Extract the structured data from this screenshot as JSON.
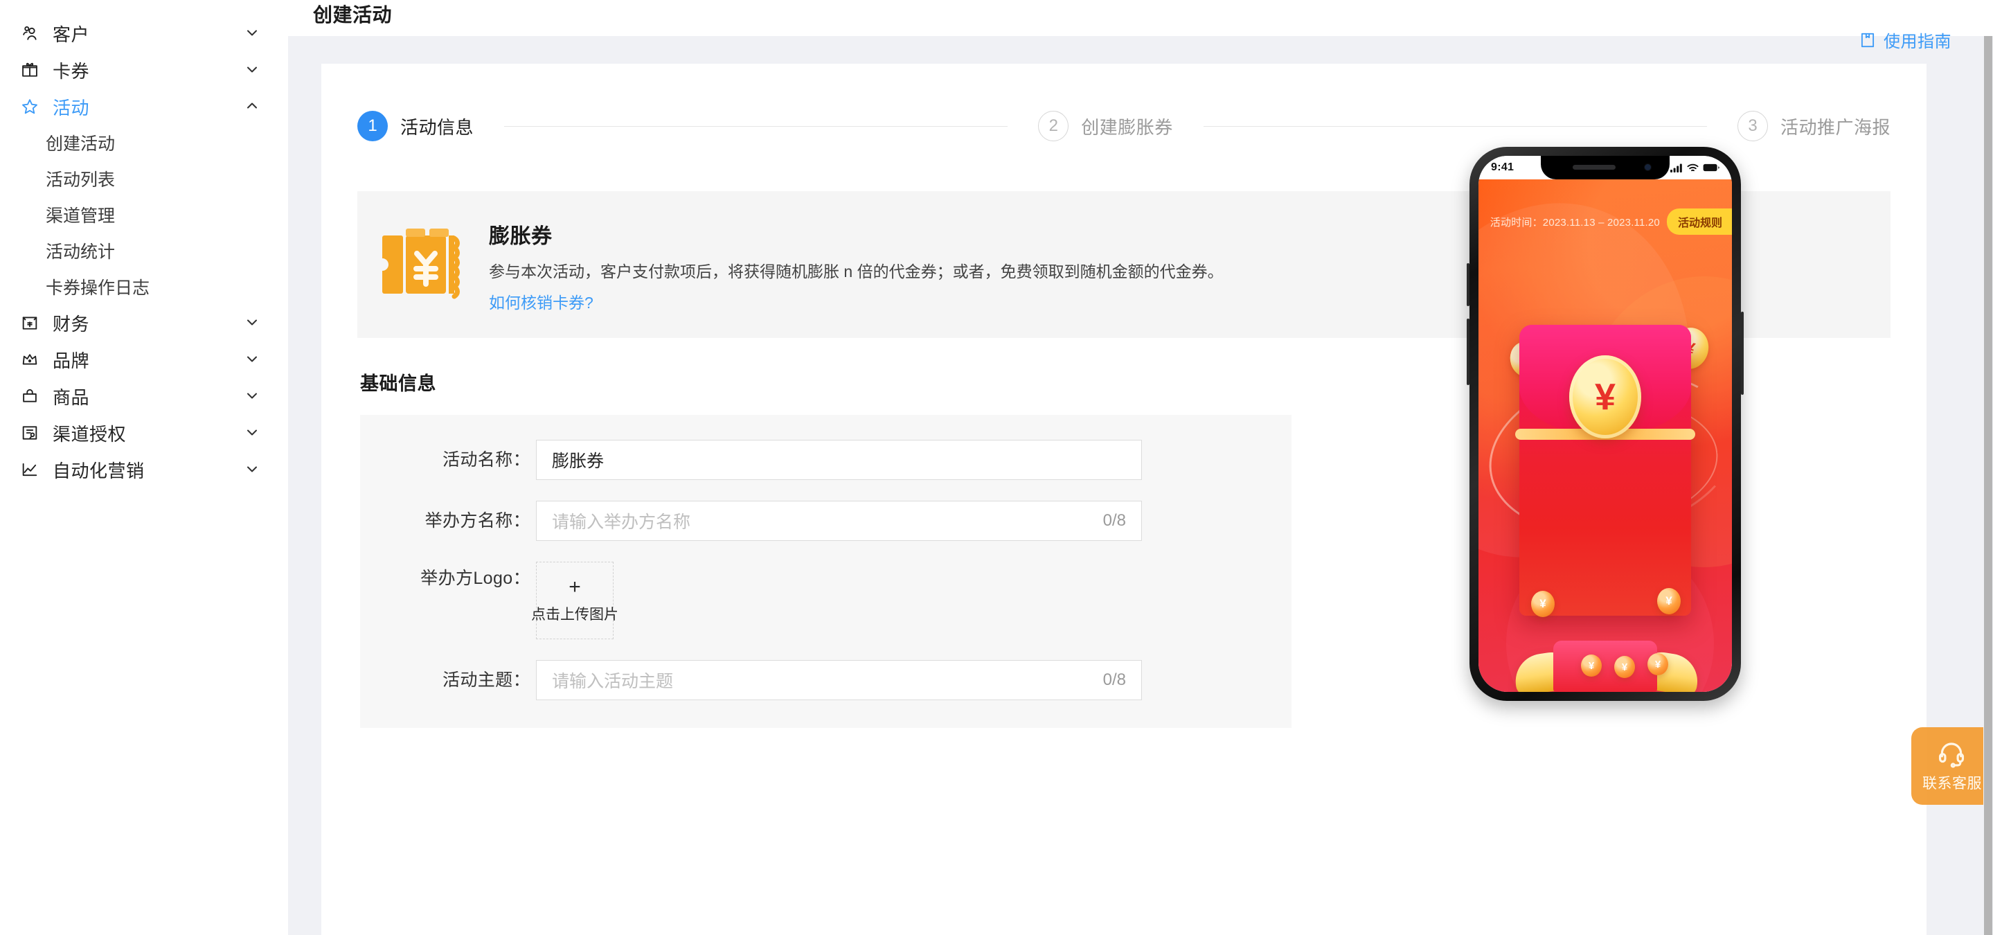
{
  "header": {
    "title": "创建活动",
    "guide_label": "使用指南",
    "guide_icon": "book-icon"
  },
  "sidebar": {
    "items": [
      {
        "label": "客户",
        "icon": "users-icon",
        "expanded": false,
        "active": false
      },
      {
        "label": "卡券",
        "icon": "gift-icon",
        "expanded": false,
        "active": false
      },
      {
        "label": "活动",
        "icon": "star-icon",
        "expanded": true,
        "active": true
      },
      {
        "label": "财务",
        "icon": "wallet-icon",
        "expanded": false,
        "active": false
      },
      {
        "label": "品牌",
        "icon": "crown-icon",
        "expanded": false,
        "active": false
      },
      {
        "label": "商品",
        "icon": "bag-icon",
        "expanded": false,
        "active": false
      },
      {
        "label": "渠道授权",
        "icon": "channel-icon",
        "expanded": false,
        "active": false
      },
      {
        "label": "自动化营销",
        "icon": "chart-line-icon",
        "expanded": false,
        "active": false
      }
    ],
    "activity_subitems": [
      "创建活动",
      "活动列表",
      "渠道管理",
      "活动统计",
      "卡券操作日志"
    ]
  },
  "steps": [
    {
      "number": "1",
      "label": "活动信息",
      "state": "active"
    },
    {
      "number": "2",
      "label": "创建膨胀券",
      "state": "idle"
    },
    {
      "number": "3",
      "label": "活动推广海报",
      "state": "idle"
    }
  ],
  "banner": {
    "icon": "coupon-yen-icon",
    "title": "膨胀券",
    "description": "参与本次活动，客户支付款项后，将获得随机膨胀 n 倍的代金券；或者，免费领取到随机金额的代金券。",
    "link_label": "如何核销卡券?"
  },
  "form": {
    "section_title": "基础信息",
    "fields": [
      {
        "label": "活动名称：",
        "type": "text",
        "value": "膨胀券",
        "placeholder": "",
        "counter": ""
      },
      {
        "label": "举办方名称：",
        "type": "text",
        "value": "",
        "placeholder": "请输入举办方名称",
        "counter": "0/8"
      },
      {
        "label": "举办方Logo：",
        "type": "upload",
        "plus": "+",
        "upload_text": "点击上传图片"
      },
      {
        "label": "活动主题：",
        "type": "text",
        "value": "",
        "placeholder": "请输入活动主题",
        "counter": "0/8"
      }
    ]
  },
  "preview": {
    "status_time": "9:41",
    "status_icons": [
      "signal-icon",
      "wifi-icon",
      "battery-icon"
    ],
    "activity_period": "活动时间：2023.11.13 – 2023.11.20",
    "rules_button": "活动规则",
    "currency_symbol": "¥"
  },
  "support": {
    "icon": "headset-icon",
    "label": "联系客服"
  },
  "colors": {
    "accent_blue": "#3d9bf7",
    "step_active": "#2f8ef4",
    "banner_orange": "#f5a623",
    "support_orange": "#f39625",
    "canvas_gray": "#f0f1f5",
    "panel_gray": "#f7f7f7"
  }
}
